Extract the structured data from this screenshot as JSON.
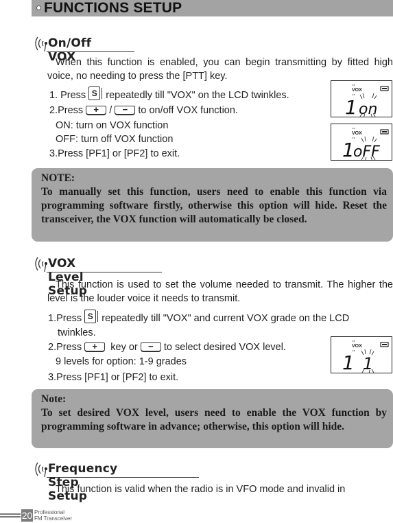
{
  "banner": {
    "title": "FUNCTIONS SETUP"
  },
  "sections": [
    {
      "title": "On/Off VOX",
      "intro": "When this function is enabled, you can begin transmitting by fitted high voice, no needing to press the [PTT] key.",
      "steps": {
        "s1_prefix": "1. Press",
        "s1_suffix": "repeatedly till \"VOX\" on the LCD twinkles.",
        "s2_prefix": "2.Press",
        "s2_sep": "/",
        "s2_suffix": "to on/off VOX function.",
        "s2_on": "ON: turn on VOX function",
        "s2_off": "OFF: turn off VOX function",
        "s3": "3.Press [PF1] or [PF2] to exit."
      },
      "note": {
        "heading": "NOTE:",
        "body": "To manually set this function, users need to enable this function via programming software firstly, otherwise this option will hide. Reset the transceiver, the VOX function will automatically be closed."
      },
      "lcds": [
        {
          "indicator": "VOX",
          "digit": "1",
          "value": "on"
        },
        {
          "indicator": "VOX",
          "digit": "1",
          "value": "oFF"
        }
      ]
    },
    {
      "title": "VOX Level Setup",
      "intro": "This function is used to set the volume needed to transmit. The higher the level is the louder voice it needs to transmit.",
      "steps": {
        "s1_prefix": "1.Press",
        "s1_suffix": "repeatedly till \"VOX\" and current VOX grade on the LCD",
        "s1_cont": "twinkles.",
        "s2_prefix": "2.Press",
        "s2_mid": "key or",
        "s2_suffix": "to select desired VOX level.",
        "s2_levels": "9 levels for option: 1-9 grades",
        "s3": "3.Press [PF1] or [PF2] to exit."
      },
      "note": {
        "heading": "Note:",
        "body": "To set desired VOX level, users need to enable the VOX function by programming software in advance; otherwise, this option will hide."
      },
      "lcds": [
        {
          "indicator": "VOX",
          "digit": "1",
          "value": "1"
        }
      ]
    },
    {
      "title": "Frequency Step Setup",
      "intro": "This function is valid when the radio is in VFO mode and invalid in"
    }
  ],
  "keys": {
    "s_key": "S",
    "plus_key": "+",
    "minus_key": "−"
  },
  "footer": {
    "page_number": "20",
    "brand_line1": "Professional",
    "brand_line2": "FM Transceiver"
  }
}
